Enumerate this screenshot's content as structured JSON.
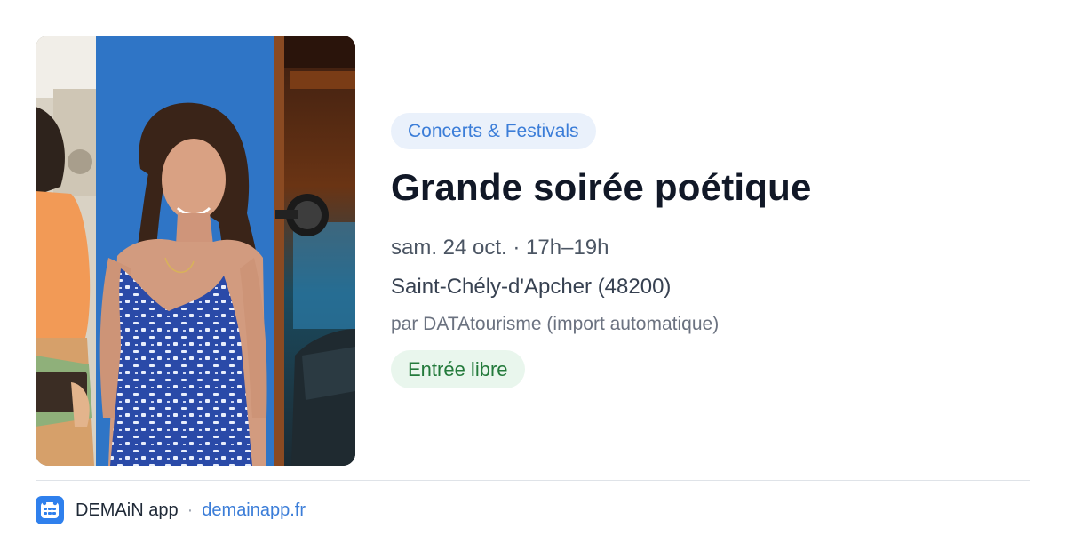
{
  "event": {
    "category": "Concerts & Festivals",
    "title": "Grande soirée poétique",
    "date": "sam. 24 oct. · 17h–19h",
    "location": "Saint-Chély-d'Apcher (48200)",
    "organizer": "par DATAtourisme (import automatique)",
    "price": "Entrée libre",
    "image_alt": "Event photo collage"
  },
  "footer": {
    "logo_icon": "demain-app-logo-icon",
    "app_name": "DEMAiN app",
    "separator": "·",
    "link_text": "demainapp.fr"
  },
  "colors": {
    "brand_blue": "#2f80ed",
    "category_text": "#3b7dd8",
    "category_bg": "#eaf1fb",
    "price_text": "#237a3b",
    "price_bg": "#e9f6ed"
  }
}
